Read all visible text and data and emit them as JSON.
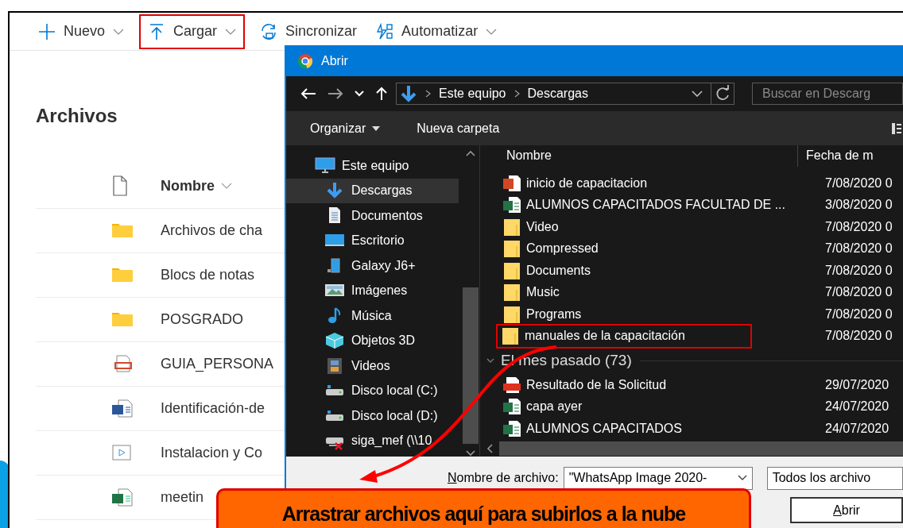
{
  "toolbar": [
    {
      "label": "Nuevo",
      "kind": "plus",
      "caret": true,
      "annotated": false
    },
    {
      "label": "Cargar",
      "kind": "upload",
      "caret": true,
      "annotated": true
    },
    {
      "label": "Sincronizar",
      "kind": "sync",
      "caret": false,
      "annotated": false
    },
    {
      "label": "Automatizar",
      "kind": "flow",
      "caret": true,
      "annotated": false
    }
  ],
  "page": {
    "title": "Archivos",
    "column": "Nombre",
    "rows": [
      {
        "name": "Archivos de cha",
        "kind": "folder"
      },
      {
        "name": "Blocs de notas",
        "kind": "folder"
      },
      {
        "name": "POSGRADO",
        "kind": "folder"
      },
      {
        "name": "GUIA_PERSONA",
        "kind": "pdf"
      },
      {
        "name": "Identificación-de",
        "kind": "word"
      },
      {
        "name": "Instalacion y Co",
        "kind": "video"
      },
      {
        "name": "meetin",
        "kind": "excel"
      }
    ]
  },
  "dialog": {
    "title": "Abrir",
    "breadcrumb": [
      "Este equipo",
      "Descargas"
    ],
    "search": {
      "placeholder": "Buscar en Descarg"
    },
    "commands": [
      {
        "label": "Organizar",
        "caret": true
      },
      {
        "label": "Nueva carpeta",
        "caret": false
      }
    ],
    "nav": [
      {
        "label": "Este equipo",
        "kind": "pc",
        "selected": false,
        "children": [
          {
            "label": "Descargas",
            "kind": "download",
            "selected": true
          },
          {
            "label": "Documentos",
            "kind": "doc",
            "selected": false
          },
          {
            "label": "Escritorio",
            "kind": "desktop",
            "selected": false
          },
          {
            "label": "Galaxy J6+",
            "kind": "phone",
            "selected": false
          },
          {
            "label": "Imágenes",
            "kind": "image",
            "selected": false
          },
          {
            "label": "Música",
            "kind": "music",
            "selected": false
          },
          {
            "label": "Objetos 3D",
            "kind": "cube",
            "selected": false
          },
          {
            "label": "Videos",
            "kind": "film",
            "selected": false
          },
          {
            "label": "Disco local (C:)",
            "kind": "drive",
            "selected": false
          },
          {
            "label": "Disco local (D:)",
            "kind": "drive",
            "selected": false
          },
          {
            "label": "siga_mef (\\\\10",
            "kind": "netdrive",
            "selected": false
          }
        ]
      }
    ],
    "columns": [
      "Nombre",
      "Fecha de m"
    ],
    "rows": [
      {
        "kind": "ppt",
        "name": "inicio de capacitacion",
        "date": "7/08/2020 0",
        "annotated": false
      },
      {
        "kind": "excel",
        "name": "ALUMNOS CAPACITADOS FACULTAD DE ...",
        "date": "3/08/2020 0",
        "annotated": false
      },
      {
        "kind": "folder",
        "name": "Video",
        "date": "7/08/2020 0",
        "annotated": false
      },
      {
        "kind": "folder",
        "name": "Compressed",
        "date": "7/08/2020 0",
        "annotated": false
      },
      {
        "kind": "folder",
        "name": "Documents",
        "date": "7/08/2020 0",
        "annotated": false
      },
      {
        "kind": "folder",
        "name": "Music",
        "date": "7/08/2020 0",
        "annotated": false
      },
      {
        "kind": "folder",
        "name": "Programs",
        "date": "7/08/2020 0",
        "annotated": false
      },
      {
        "kind": "folder",
        "name": "manuales de la capacitación",
        "date": "7/08/2020 0",
        "annotated": true
      },
      {
        "kind": "group",
        "name": "El mes pasado (73)",
        "expanded": true
      },
      {
        "kind": "pdf",
        "name": "Resultado de la Solicitud",
        "date": "29/07/2020",
        "annotated": false
      },
      {
        "kind": "excel",
        "name": "capa ayer",
        "date": "24/07/2020",
        "annotated": false
      },
      {
        "kind": "excel",
        "name": "ALUMNOS CAPACITADOS",
        "date": "24/07/2020",
        "annotated": false
      }
    ],
    "filename": {
      "label": "Nombre de archivo:",
      "value": "\"WhatsApp Image 2020-"
    },
    "filetype": "Todos los archivo",
    "open_button": "Abrir"
  },
  "callout": "Arrastrar archivos aquí para subirlos a la nube"
}
